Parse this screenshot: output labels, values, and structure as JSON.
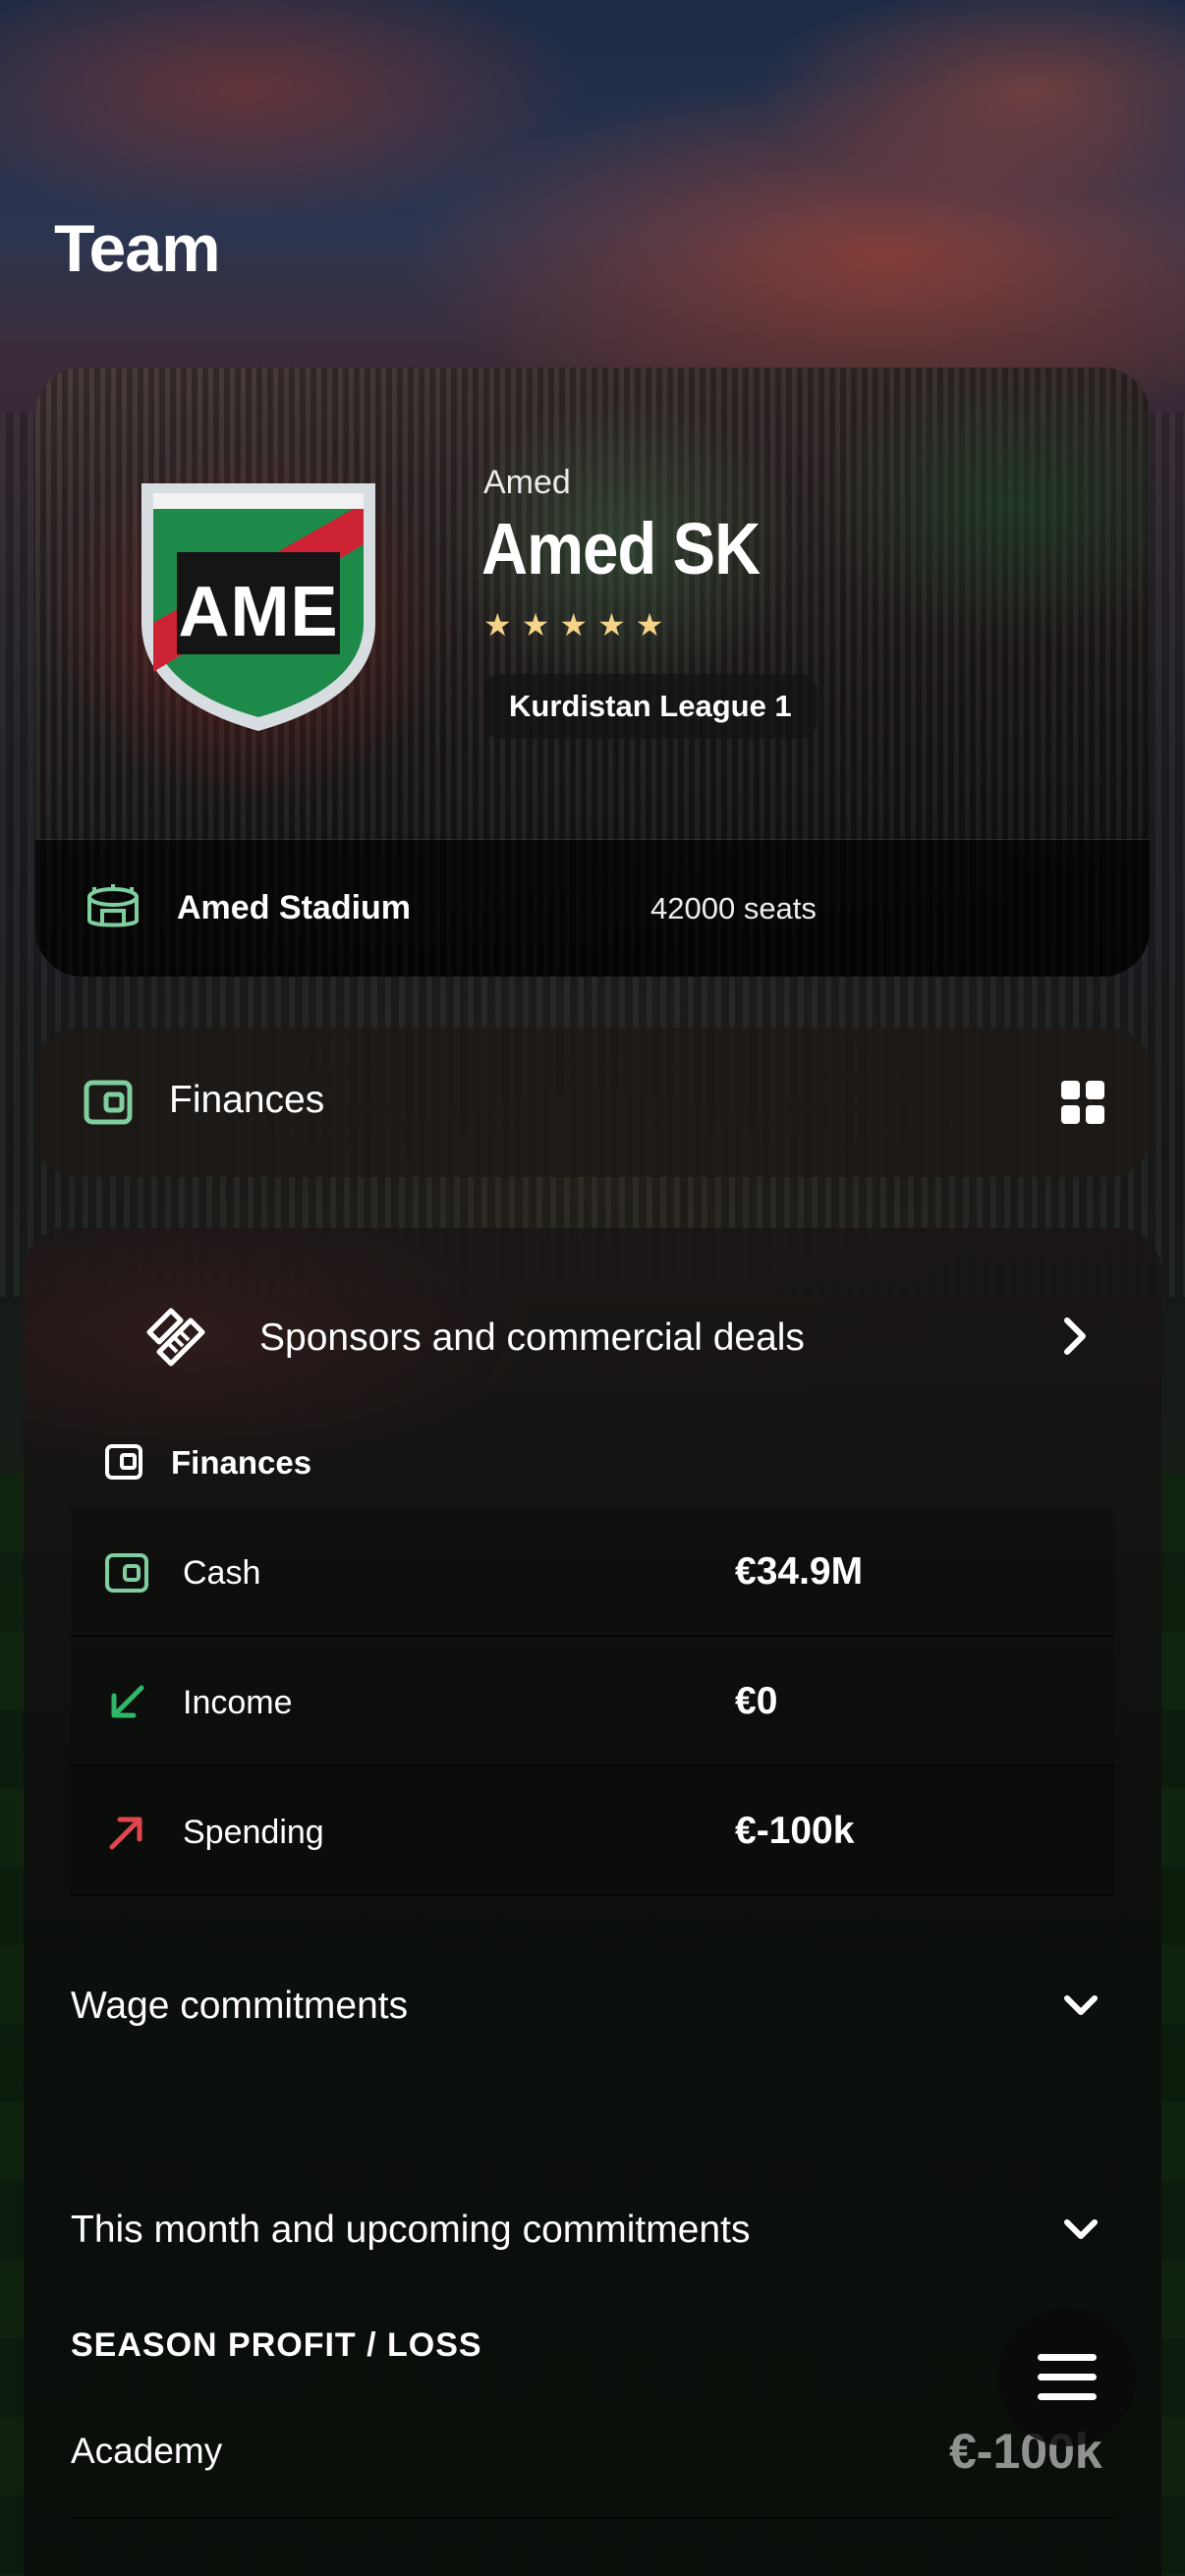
{
  "page": {
    "title": "Team"
  },
  "team": {
    "crest_text": "AME",
    "city": "Amed",
    "name": "Amed SK",
    "stars": 5,
    "league": "Kurdistan League 1",
    "stadium": {
      "name": "Amed Stadium",
      "seats": "42000 seats"
    }
  },
  "finances_bar": {
    "label": "Finances",
    "icon": "wallet-icon",
    "action_icon": "grid-icon"
  },
  "sponsors": {
    "label": "Sponsors and commercial deals",
    "icon": "handshake-icon"
  },
  "finances": {
    "title": "Finances",
    "rows": [
      {
        "label": "Cash",
        "value": "€34.9M",
        "icon": "wallet-icon"
      },
      {
        "label": "Income",
        "value": "€0",
        "icon": "arrow-down-left-icon"
      },
      {
        "label": "Spending",
        "value": "€-100k",
        "icon": "arrow-up-right-icon"
      }
    ]
  },
  "sections": {
    "wages": "Wage commitments",
    "upcoming": "This month and upcoming commitments"
  },
  "season": {
    "title": "SEASON PROFIT / LOSS",
    "academy_label": "Academy",
    "academy_value": "€-100k"
  },
  "colors": {
    "accent_green": "#7fcf9e",
    "income_green": "#2fb86a",
    "spending_red": "#e0474c",
    "star_gold": "#f5d389"
  }
}
